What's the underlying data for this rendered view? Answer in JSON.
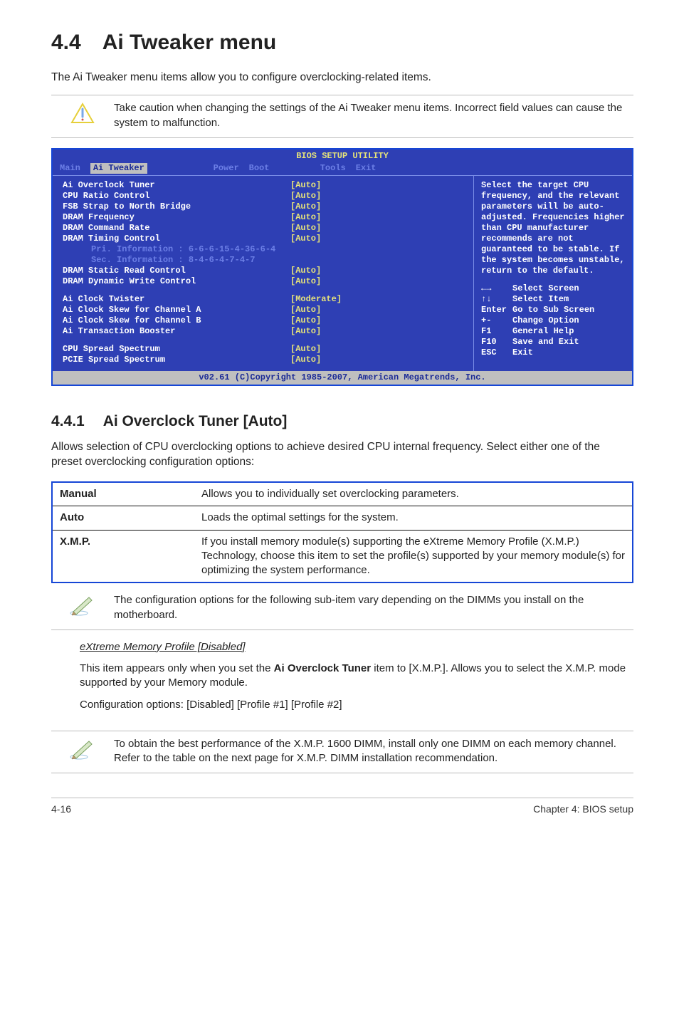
{
  "header": {
    "section_number": "4.4",
    "section_title": "Ai Tweaker menu",
    "intro": "The Ai Tweaker menu items allow you to configure overclocking-related items."
  },
  "caution_note": "Take caution when changing the settings of the Ai Tweaker menu items. Incorrect field values can cause the system to malfunction.",
  "bios": {
    "title": "BIOS SETUP UTILITY",
    "tabs": [
      "Main",
      "Ai Tweaker",
      "Power",
      "Boot",
      "Tools",
      "Exit"
    ],
    "active_tab": "Ai Tweaker",
    "left_rows": [
      {
        "label": "Ai Overclock Tuner",
        "value": "[Auto]"
      },
      {
        "label": "CPU Ratio Control",
        "value": "[Auto]"
      },
      {
        "label": "FSB Strap to North Bridge",
        "value": "[Auto]"
      },
      {
        "label": "DRAM Frequency",
        "value": "[Auto]"
      },
      {
        "label": "DRAM Command Rate",
        "value": "[Auto]"
      },
      {
        "label": "DRAM Timing Control",
        "value": "[Auto]"
      }
    ],
    "sub_rows": [
      "Pri. Information : 6-6-6-15-4-36-6-4",
      "Sec. Information : 8-4-6-4-7-4-7"
    ],
    "left_rows2": [
      {
        "label": "DRAM Static Read Control",
        "value": "[Auto]"
      },
      {
        "label": "DRAM Dynamic Write Control",
        "value": "[Auto]"
      }
    ],
    "left_rows3": [
      {
        "label": "Ai Clock Twister",
        "value": "[Moderate]"
      },
      {
        "label": "Ai Clock Skew for Channel A",
        "value": "[Auto]"
      },
      {
        "label": "Ai Clock Skew for Channel B",
        "value": "[Auto]"
      },
      {
        "label": "Ai Transaction Booster",
        "value": "[Auto]"
      }
    ],
    "left_rows4": [
      {
        "label": "CPU Spread Spectrum",
        "value": "[Auto]"
      },
      {
        "label": "PCIE Spread Spectrum",
        "value": "[Auto]"
      }
    ],
    "help_text": "Select the target CPU frequency, and the relevant parameters will be auto-adjusted. Frequencies higher than CPU manufacturer recommends are not guaranteed to be stable. If the system becomes unstable, return to the default.",
    "keys": [
      {
        "sym": "←→",
        "txt": "Select Screen"
      },
      {
        "sym": "↑↓",
        "txt": "Select Item"
      },
      {
        "sym": "Enter",
        "txt": "Go to Sub Screen"
      },
      {
        "sym": "+-",
        "txt": "Change Option"
      },
      {
        "sym": "F1",
        "txt": "General Help"
      },
      {
        "sym": "F10",
        "txt": "Save and Exit"
      },
      {
        "sym": "ESC",
        "txt": "Exit"
      }
    ],
    "footer": "v02.61 (C)Copyright 1985-2007, American Megatrends, Inc."
  },
  "subsection": {
    "number": "4.4.1",
    "title": "Ai Overclock Tuner [Auto]",
    "intro": "Allows selection of CPU overclocking options to achieve desired CPU internal frequency. Select either one of the preset overclocking configuration options:"
  },
  "options_table": [
    {
      "k": "Manual",
      "v": "Allows you to individually set overclocking parameters."
    },
    {
      "k": "Auto",
      "v": "Loads the optimal settings for the system."
    },
    {
      "k": "X.M.P.",
      "v": "If you install memory module(s) supporting the eXtreme Memory Profile (X.M.P.) Technology, choose this item to set the profile(s) supported by your memory module(s) for optimizing the system performance."
    }
  ],
  "config_note": "The configuration options for the following sub-item vary depending on the DIMMs you install on the motherboard.",
  "extreme": {
    "heading": "eXtreme Memory Profile [Disabled]",
    "body1_a": "This item appears only when you set the ",
    "body1_b": "Ai Overclock Tuner",
    "body1_c": " item to [X.M.P.]. Allows you to select the X.M.P. mode supported by your Memory module.",
    "body2": "Configuration options: [Disabled] [Profile #1] [Profile #2]"
  },
  "perf_note": "To obtain the best performance of the X.M.P. 1600 DIMM, install only one DIMM on each memory channel. Refer to the table on the next page for X.M.P. DIMM installation recommendation.",
  "footer": {
    "left": "4-16",
    "right": "Chapter 4: BIOS setup"
  }
}
